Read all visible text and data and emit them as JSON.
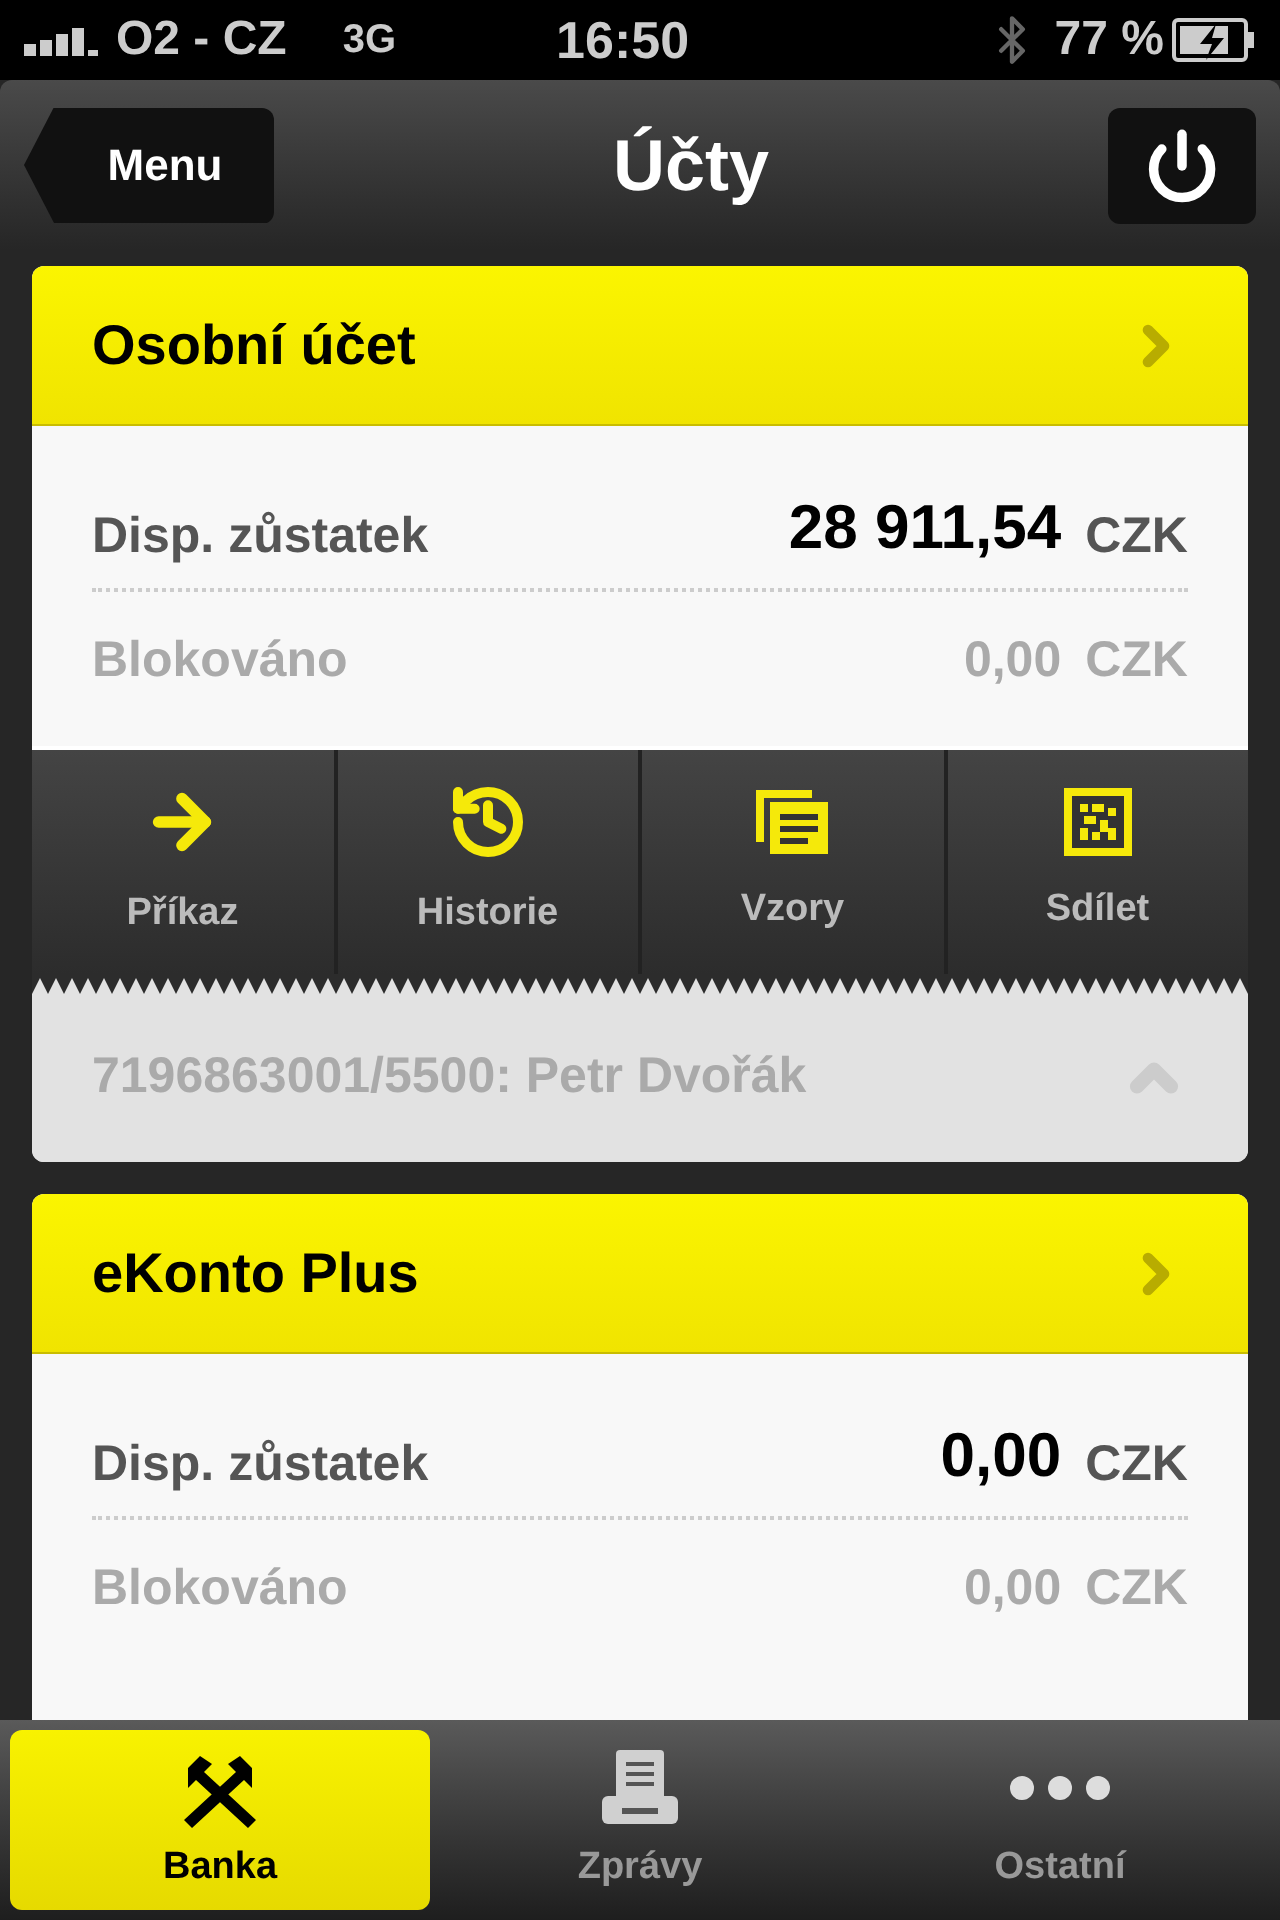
{
  "status_bar": {
    "carrier": "O2 - CZ",
    "network": "3G",
    "time": "16:50",
    "battery": "77 %"
  },
  "nav": {
    "back": "Menu",
    "title": "Účty"
  },
  "accounts": [
    {
      "name": "Osobní účet",
      "rows": [
        {
          "kind": "available",
          "label": "Disp. zůstatek",
          "amount": "28 911,54",
          "currency": "CZK"
        },
        {
          "kind": "blocked",
          "label": "Blokováno",
          "amount": "0,00",
          "currency": "CZK"
        }
      ],
      "actions": [
        {
          "kind": "arrow",
          "label": "Příkaz"
        },
        {
          "kind": "history",
          "label": "Historie"
        },
        {
          "kind": "templates",
          "label": "Vzory"
        },
        {
          "kind": "share",
          "label": "Sdílet"
        }
      ],
      "account_line": "7196863001/5500: Petr Dvořák"
    },
    {
      "name": "eKonto Plus",
      "rows": [
        {
          "kind": "available",
          "label": "Disp. zůstatek",
          "amount": "0,00",
          "currency": "CZK"
        },
        {
          "kind": "blocked",
          "label": "Blokováno",
          "amount": "0,00",
          "currency": "CZK"
        }
      ]
    }
  ],
  "tabs": [
    {
      "kind": "bank",
      "label": "Banka",
      "selected": true
    },
    {
      "kind": "messages",
      "label": "Zprávy",
      "selected": false
    },
    {
      "kind": "more",
      "label": "Ostatní",
      "selected": false
    }
  ]
}
